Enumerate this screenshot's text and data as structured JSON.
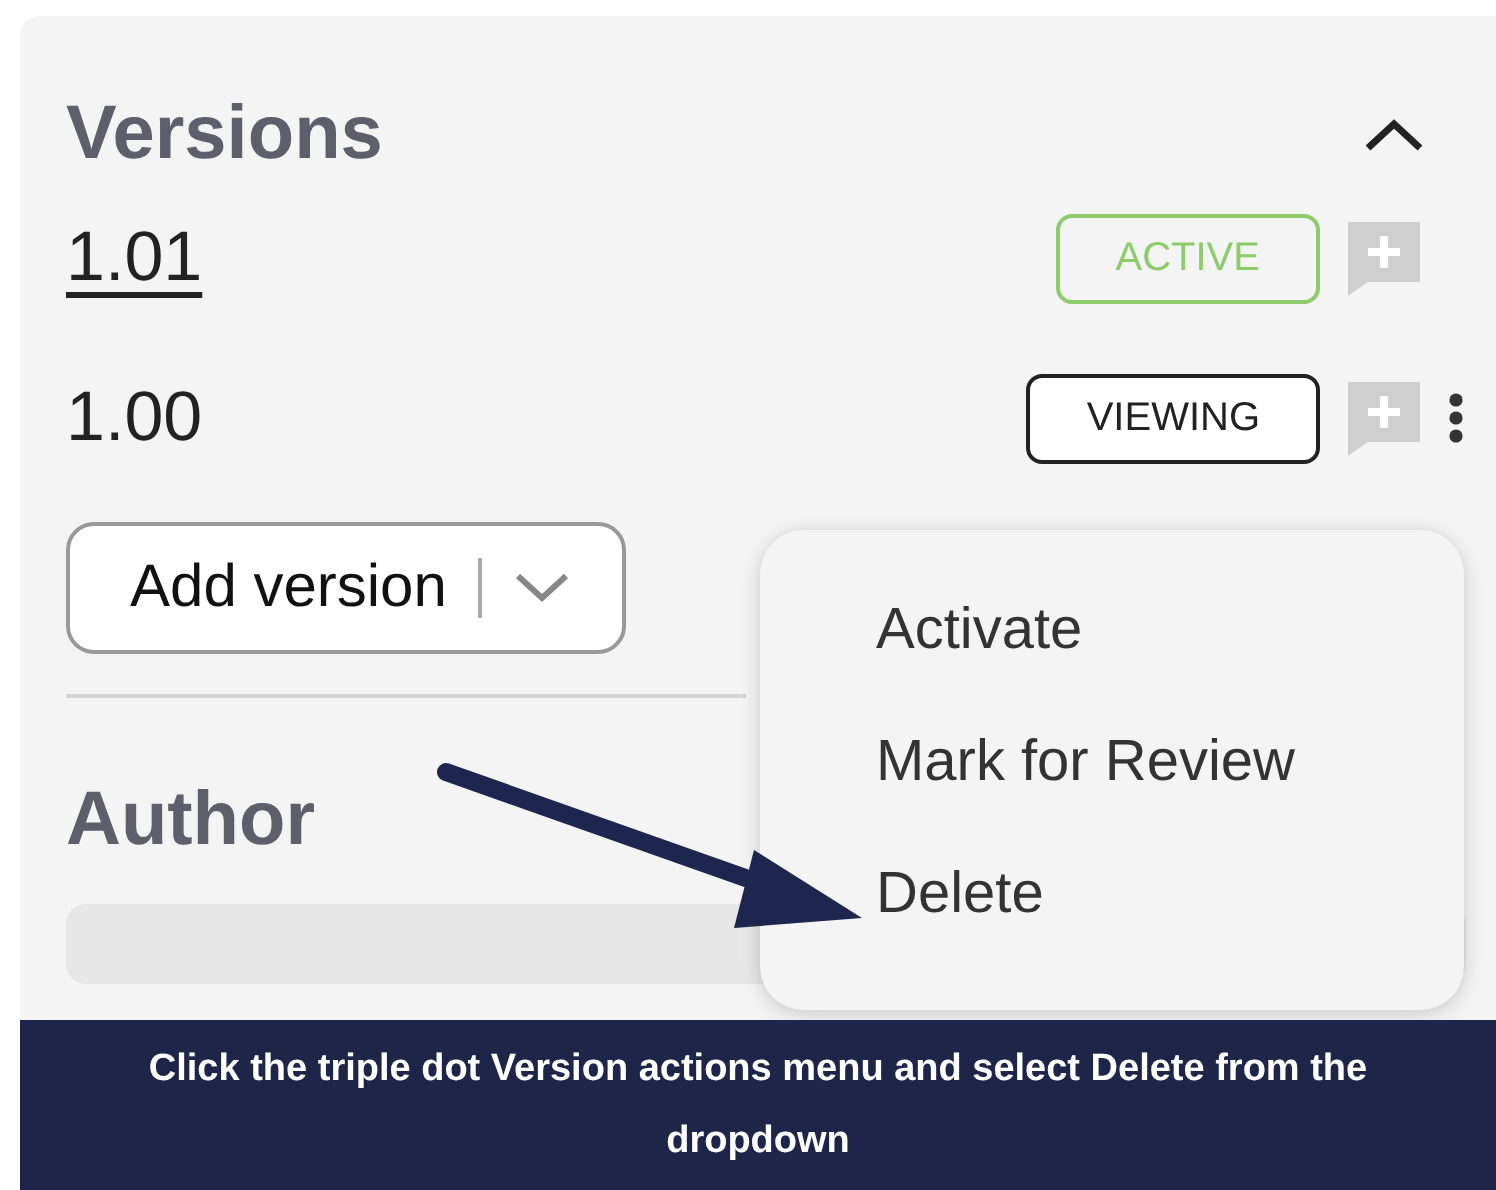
{
  "versions": {
    "title": "Versions",
    "expanded": true,
    "rows": [
      {
        "number": "1.01",
        "link": true,
        "badge": {
          "label": "ACTIVE",
          "kind": "active"
        },
        "has_menu": false
      },
      {
        "number": "1.00",
        "link": false,
        "badge": {
          "label": "VIEWING",
          "kind": "viewing"
        },
        "has_menu": true
      }
    ],
    "add_button": "Add version"
  },
  "menu": {
    "items": [
      "Activate",
      "Mark for Review",
      "Delete"
    ]
  },
  "author": {
    "title": "Author"
  },
  "caption": "Click the triple dot Version actions menu and select Delete from the dropdown"
}
